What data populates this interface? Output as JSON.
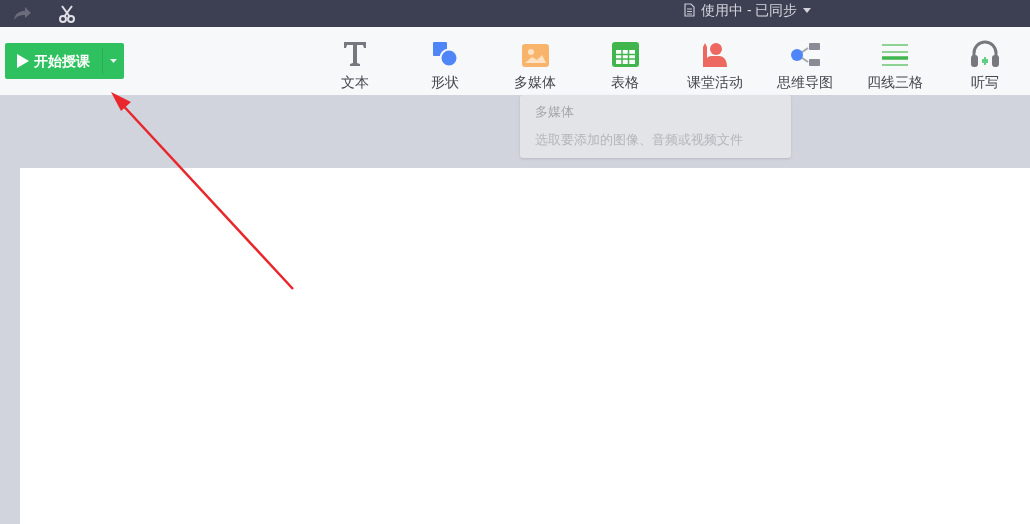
{
  "title_bar": {
    "status": "使用中 - 已同步"
  },
  "start_button": {
    "label": "开始授课"
  },
  "toolbar": [
    {
      "label": "文本"
    },
    {
      "label": "形状"
    },
    {
      "label": "多媒体"
    },
    {
      "label": "表格"
    },
    {
      "label": "课堂活动"
    },
    {
      "label": "思维导图"
    },
    {
      "label": "四线三格"
    },
    {
      "label": "听写"
    }
  ],
  "tooltip": {
    "title": "多媒体",
    "description": "选取要添加的图像、音频或视频文件"
  }
}
